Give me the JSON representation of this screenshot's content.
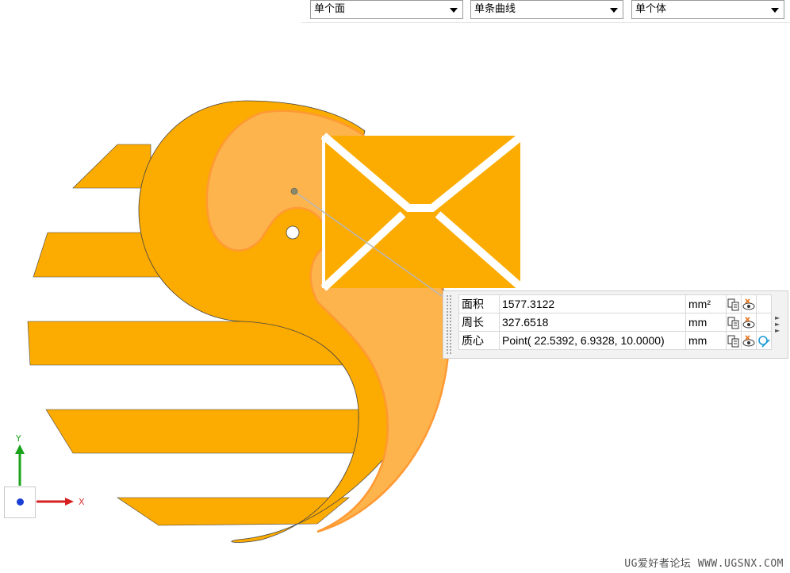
{
  "toolbar": {
    "face_filter": "单个面",
    "curve_filter": "单条曲线",
    "body_filter": "单个体"
  },
  "measure": {
    "rows": [
      {
        "label": "面积",
        "value": "1577.3122",
        "unit": "mm²"
      },
      {
        "label": "周长",
        "value": "327.6518",
        "unit": "mm"
      },
      {
        "label": "质心",
        "value": "Point( 22.5392, 6.9328, 10.0000)",
        "unit": "mm"
      }
    ]
  },
  "triad": {
    "y_label": "Y",
    "x_label": "X"
  },
  "colors": {
    "logo_orange": "#fcab00",
    "highlight_orange": "#fdb44d",
    "highlight_edge": "#ff9933",
    "axis_y": "#1aa31a",
    "axis_x": "#d62020",
    "origin": "#1a3fd4"
  },
  "icons": [
    "copy-icon",
    "hide-icon",
    "centroid-icon",
    "expand-arrows-icon"
  ],
  "watermark": "UG爱好者论坛 WWW.UGSNX.COM"
}
